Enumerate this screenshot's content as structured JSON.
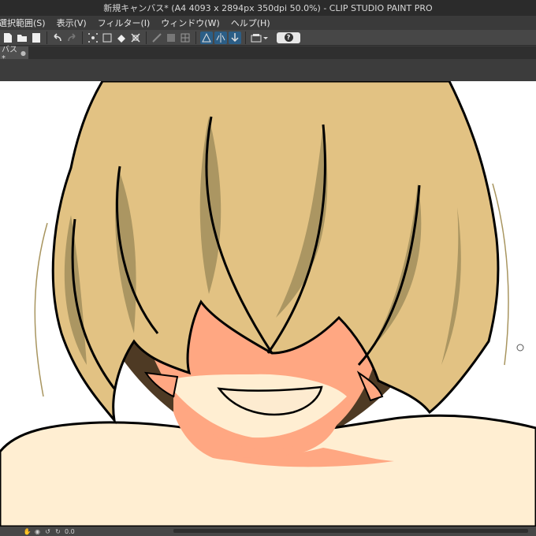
{
  "window": {
    "title": "新規キャンバス* (A4 4093 x 2894px 350dpi 50.0%) - CLIP STUDIO PAINT PRO"
  },
  "menu": {
    "items": [
      "選択範囲(S)",
      "表示(V)",
      "フィルター(I)",
      "ウィンドウ(W)",
      "ヘルプ(H)"
    ]
  },
  "tab": {
    "label": "バス*",
    "close": "●"
  },
  "toolbar": {
    "icons": [
      "new-file-icon",
      "open-file-icon",
      "save-icon",
      "undo-icon",
      "redo-icon",
      "transform-icon",
      "crop-icon",
      "fill-icon",
      "select-icon",
      "ruler-icon",
      "snap-icon",
      "grid-icon",
      "perspective-icon",
      "symmetry-icon",
      "guide-icon",
      "settings-icon",
      "help-icon"
    ]
  },
  "status": {
    "zoom_label": "0.0"
  },
  "colors": {
    "hair": "#e2c283",
    "hair_shadow": "#ab9662",
    "hair_back": "#4e3a24",
    "skin": "#ffa782",
    "skin_light": "#ffeed2",
    "line": "#000000",
    "active_button": "#2c5e86"
  }
}
